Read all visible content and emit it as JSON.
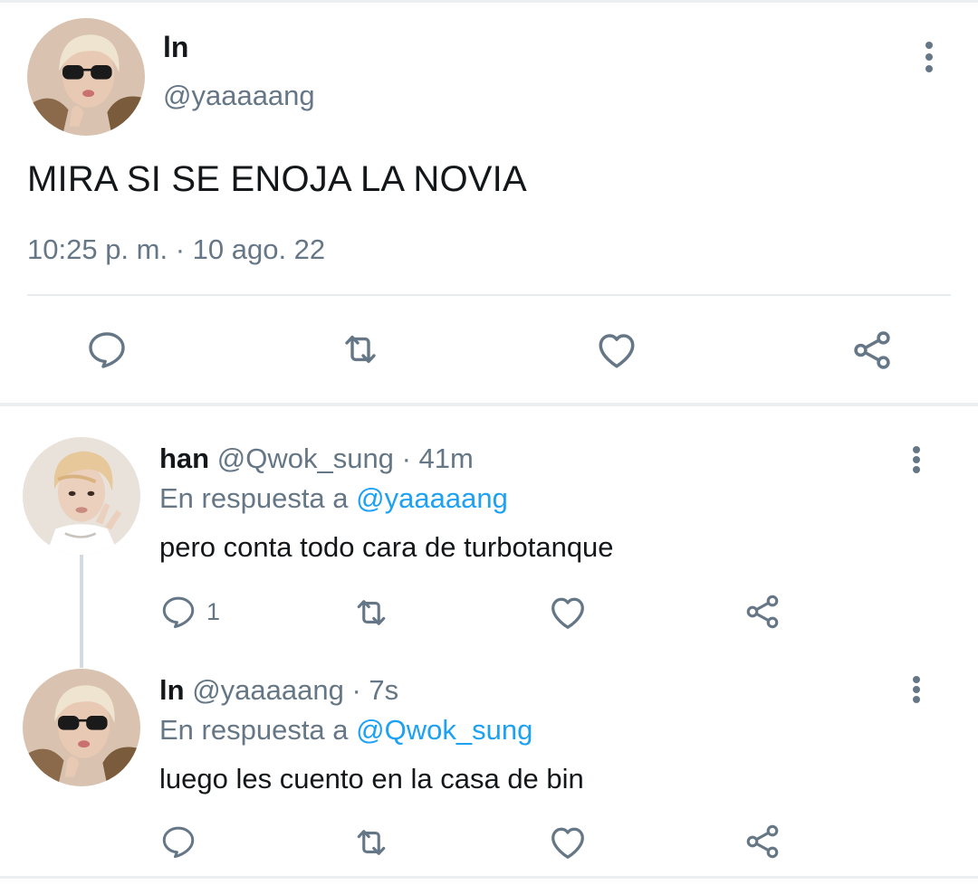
{
  "main_tweet": {
    "name": "ln",
    "handle": "@yaaaaang",
    "text": "MIRA SI SE ENOJA LA NOVIA",
    "timestamp": "10:25 p. m. · 10 ago. 22",
    "actions": [
      "reply-icon",
      "retweet-icon",
      "like-icon",
      "share-icon"
    ]
  },
  "replies": [
    {
      "name": "han",
      "handle": "@Qwok_sung",
      "separator": "·",
      "time": "41m",
      "reply_prefix": "En respuesta a",
      "reply_to": "@yaaaaang",
      "text": "pero conta todo cara de turbotanque",
      "reply_count": "1"
    },
    {
      "name": "ln",
      "handle": "@yaaaaang",
      "separator": "·",
      "time": "7s",
      "reply_prefix": "En respuesta a",
      "reply_to": "@Qwok_sung",
      "text": "luego les cuento en la casa de bin",
      "reply_count": ""
    }
  ],
  "colors": {
    "text": "#14171a",
    "secondary": "#657786",
    "link": "#1da1f2",
    "divider": "#e6ecf0"
  }
}
